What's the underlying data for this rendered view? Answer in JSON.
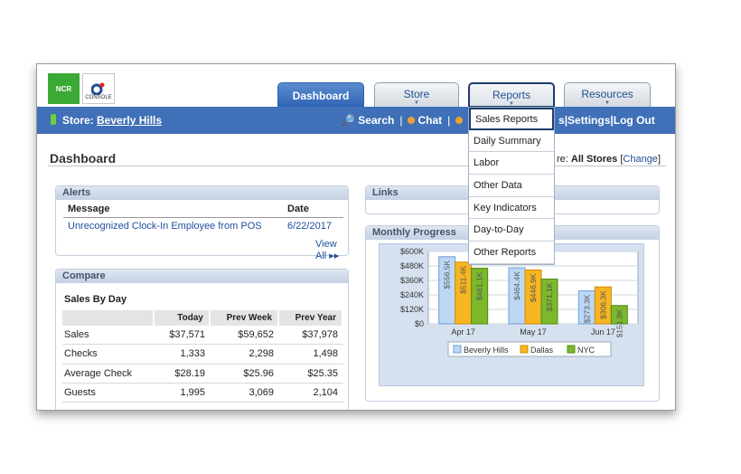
{
  "header": {
    "ncr_logo": "NCR",
    "console_logo": "CONSOLE",
    "tabs": [
      "Dashboard",
      "Store",
      "Reports",
      "Resources"
    ]
  },
  "navbar": {
    "store_label": "Store:",
    "store_name": "Beverly Hills",
    "search": "Search",
    "chat": "Chat",
    "hidden_suffix": "s",
    "settings": "Settings",
    "logout": "Log Out",
    "separator": "|"
  },
  "reports_menu": [
    "Sales Reports",
    "Daily Summary",
    "Labor",
    "Other Data",
    "Key Indicators",
    "Day-to-Day",
    "Other Reports"
  ],
  "page": {
    "title": "Dashboard",
    "store_filter_prefix": "re:",
    "store_filter_value": "All Stores",
    "change_open": "[",
    "change_link": "Change",
    "change_close": "]"
  },
  "alerts": {
    "title": "Alerts",
    "col_message": "Message",
    "col_date": "Date",
    "rows": [
      {
        "message": "Unrecognized Clock-In Employee from POS",
        "date": "6/22/2017"
      }
    ],
    "view_all": "View All ▸▸"
  },
  "links": {
    "title": "Links"
  },
  "compare": {
    "title": "Compare",
    "subtitle": "Sales By Day",
    "columns": [
      "",
      "Today",
      "Prev Week",
      "Prev Year"
    ],
    "rows": [
      [
        "Sales",
        "$37,571",
        "$59,652",
        "$37,978"
      ],
      [
        "Checks",
        "1,333",
        "2,298",
        "1,498"
      ],
      [
        "Average Check",
        "$28.19",
        "$25.96",
        "$25.35"
      ],
      [
        "Guests",
        "1,995",
        "3,069",
        "2,104"
      ]
    ]
  },
  "progress": {
    "title": "Monthly Progress"
  },
  "colors": {
    "nav_blue": "#3f70b8",
    "beverly": "#bcd8f5",
    "dallas": "#f6b522",
    "nyc": "#7cb82b"
  },
  "chart_data": {
    "type": "bar",
    "categories": [
      "Apr 17",
      "May 17",
      "Jun 17"
    ],
    "series": [
      {
        "name": "Beverly Hills",
        "values": [
          556.5,
          464.4,
          273.3
        ],
        "labels": [
          "$556.5K",
          "$464.4K",
          "$273.3K"
        ]
      },
      {
        "name": "Dallas",
        "values": [
          511.4,
          446.9,
          306.3
        ],
        "labels": [
          "$511.4K",
          "$446.9K",
          "$306.3K"
        ]
      },
      {
        "name": "NYC",
        "values": [
          461.1,
          371.1,
          151.9
        ],
        "labels": [
          "$461.1K",
          "$371.1K",
          "$151.9K"
        ]
      }
    ],
    "y_ticks": [
      "$0",
      "$120K",
      "$240K",
      "$360K",
      "$480K",
      "$600K"
    ],
    "ylim": [
      0,
      600
    ],
    "legend_position": "bottom",
    "grid": true
  }
}
